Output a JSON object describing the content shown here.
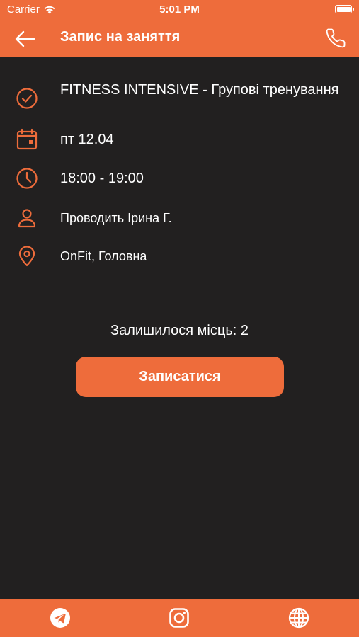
{
  "status_bar": {
    "carrier": "Carrier",
    "time": "5:01 PM"
  },
  "header": {
    "title": "Запис на заняття",
    "back_icon": "arrow-left-icon",
    "phone_icon": "phone-icon"
  },
  "class_info": {
    "name": "FITNESS INTENSIVE - Групові тренування",
    "date": "пт 12.04",
    "time": "18:00 - 19:00",
    "trainer": "Проводить Ірина Г.",
    "location": "OnFit, Головна"
  },
  "seats_left": "Залишилося місць: 2",
  "signup_button": "Записатися",
  "footer": {
    "icons": [
      "telegram-icon",
      "instagram-icon",
      "globe-icon"
    ]
  },
  "colors": {
    "accent": "#ee6c3b",
    "background": "#222020",
    "text": "#ffffff"
  }
}
